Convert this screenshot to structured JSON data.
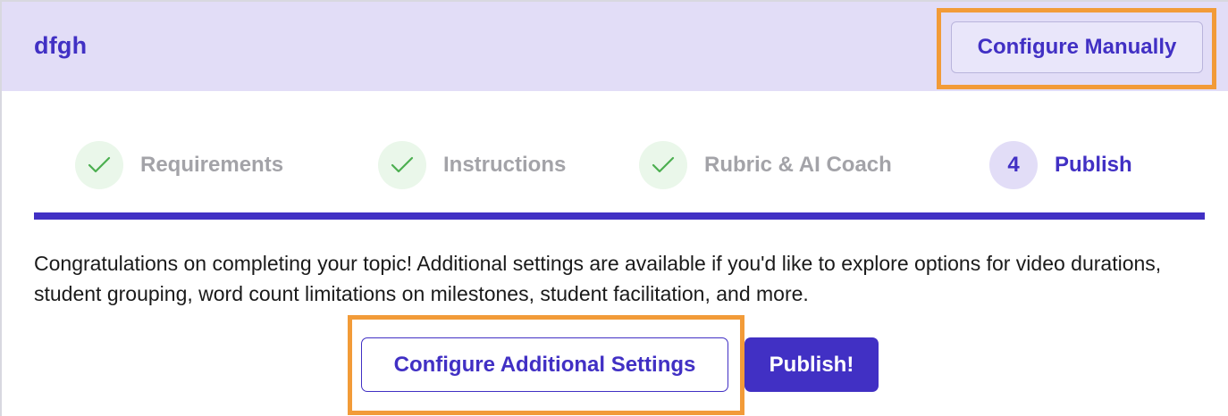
{
  "header": {
    "topic_title": "dfgh",
    "configure_manually_label": "Configure Manually"
  },
  "stepper": {
    "steps": [
      {
        "label": "Requirements",
        "status": "complete",
        "icon": "check-icon"
      },
      {
        "label": "Instructions",
        "status": "complete",
        "icon": "check-icon"
      },
      {
        "label": "Rubric & AI Coach",
        "status": "complete",
        "icon": "check-icon"
      },
      {
        "number": "4",
        "label": "Publish",
        "status": "active"
      }
    ],
    "progress_fraction": 1.0
  },
  "main": {
    "message": "Congratulations on completing your topic! Additional settings are available if you'd like to explore options for video durations, student grouping, word count limitations on milestones, student facilitation, and more.",
    "configure_additional_label": "Configure Additional Settings",
    "publish_label": "Publish!"
  },
  "colors": {
    "brand": "#4130c4",
    "header_bg": "#e2ddf7",
    "complete_green": "#4caf50",
    "highlight_orange": "#f29b38"
  }
}
